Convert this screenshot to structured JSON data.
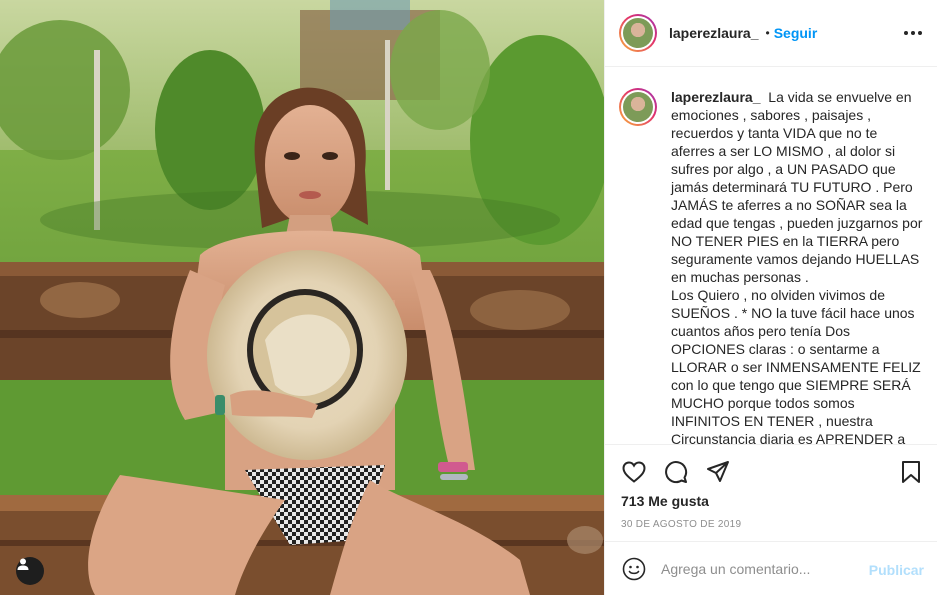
{
  "post": {
    "username": "laperezlaura_",
    "dot": "•",
    "follow_label": "Seguir",
    "caption": "La vida se envuelve en emociones , sabores , paisajes , recuerdos y tanta VIDA que no te aferres a ser LO MISMO , al dolor si sufres por algo , a UN PASADO que jamás determinará TU FUTURO . Pero JAMÁS te aferres a no SOÑAR sea la edad que tengas , pueden juzgarnos por NO TENER PIES en la TIERRA pero seguramente vamos dejando HUELLAS en muchas personas .\nLos Quiero , no olviden vivimos de SUEÑOS . * NO la tuve fácil hace unos cuantos años pero tenía Dos OPCIONES claras : o sentarme a LLORAR o ser INMENSAMENTE FELIZ con lo que tengo que SIEMPRE SERÁ MUCHO porque todos somos INFINITOS EN TENER , nuestra Circunstancia diaria es APRENDER a",
    "likes": "713 Me gusta",
    "date": "30 DE AGOSTO DE 2019"
  },
  "comment": {
    "placeholder": "Agrega un comentario...",
    "post_label": "Publicar"
  },
  "icons": {
    "like": "heart-icon",
    "comment": "comment-icon",
    "share": "share-icon",
    "save": "bookmark-icon",
    "emoji": "emoji-icon",
    "tag": "user-tag-icon",
    "more": "more-options-icon"
  },
  "colors": {
    "accent": "#0095f6",
    "publish_disabled": "#b2dffc",
    "muted": "#8e8e8e"
  }
}
